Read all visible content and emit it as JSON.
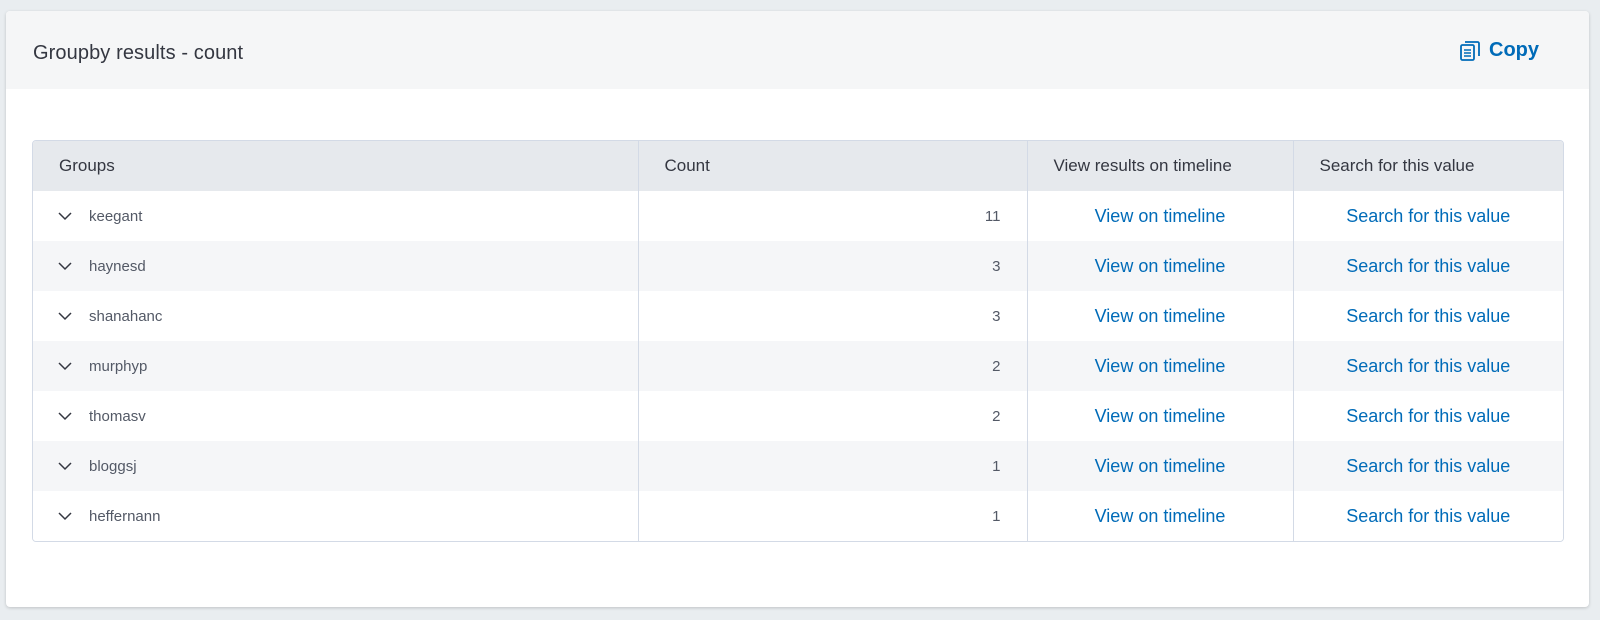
{
  "panel": {
    "title": "Groupby results - count",
    "copy_label": "Copy"
  },
  "table": {
    "headers": [
      "Groups",
      "Count",
      "View results on timeline",
      "Search for this value"
    ],
    "rows": [
      {
        "group": "keegant",
        "count": "11",
        "view": "View on timeline",
        "search": "Search for this value"
      },
      {
        "group": "haynesd",
        "count": "3",
        "view": "View on timeline",
        "search": "Search for this value"
      },
      {
        "group": "shanahanc",
        "count": "3",
        "view": "View on timeline",
        "search": "Search for this value"
      },
      {
        "group": "murphyp",
        "count": "2",
        "view": "View on timeline",
        "search": "Search for this value"
      },
      {
        "group": "thomasv",
        "count": "2",
        "view": "View on timeline",
        "search": "Search for this value"
      },
      {
        "group": "bloggsj",
        "count": "1",
        "view": "View on timeline",
        "search": "Search for this value"
      },
      {
        "group": "heffernann",
        "count": "1",
        "view": "View on timeline",
        "search": "Search for this value"
      }
    ]
  },
  "icons": {
    "copy": "copy-icon",
    "expand": "chevron-down-icon"
  },
  "colors": {
    "link": "#006bb8",
    "header_bg": "#e6e9ed",
    "panel_header_bg": "#f5f6f7",
    "page_bg": "#e9edf0"
  }
}
